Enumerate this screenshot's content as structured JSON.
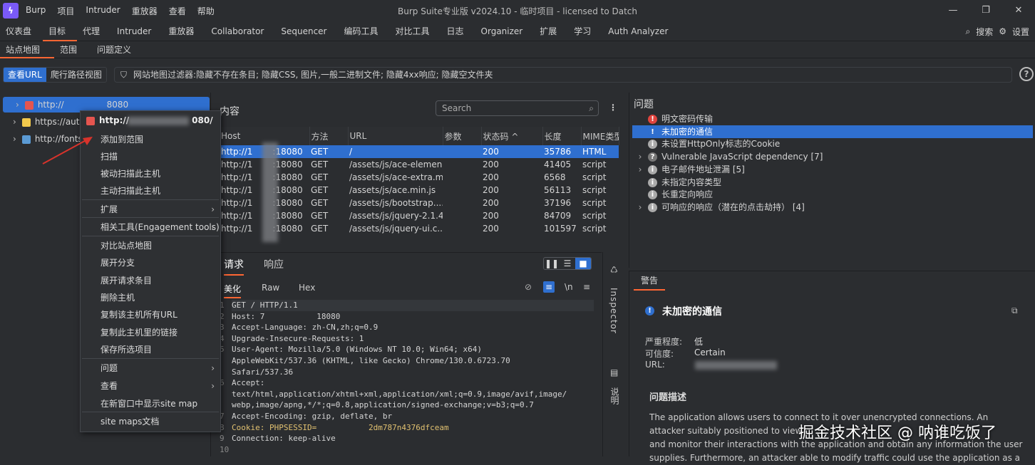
{
  "titlebar": {
    "menus": [
      "Burp",
      "项目",
      "Intruder",
      "重放器",
      "查看",
      "帮助"
    ],
    "title": "Burp Suite专业版  v2024.10 - 临时项目 - licensed to Datch"
  },
  "main_tabs": [
    "仪表盘",
    "目标",
    "代理",
    "Intruder",
    "重放器",
    "Collaborator",
    "Sequencer",
    "编码工具",
    "对比工具",
    "日志",
    "Organizer",
    "扩展",
    "学习",
    "Auth Analyzer"
  ],
  "main_tabs_right": {
    "search": "搜索",
    "settings": "设置"
  },
  "sub_tabs": [
    "站点地图",
    "范围",
    "问题定义"
  ],
  "view_toggle": {
    "url": "查看URL",
    "crawl": "爬行路径视图"
  },
  "filter_text": "网站地图过滤器:隐藏不存在条目; 隐藏CSS, 图片,一般二进制文件; 隐藏4xx响应; 隐藏空文件夹",
  "tree": [
    {
      "label": "http://",
      "suffix": "8080",
      "color": "#e5554f"
    },
    {
      "label": "https://auth",
      "suffix": "",
      "color": "#f2c94c"
    },
    {
      "label": "http://fonts",
      "suffix": "",
      "color": "#5b9bd5"
    }
  ],
  "context_menu": {
    "header": "http://",
    "header_suffix": "080/",
    "items": [
      "添加到范围",
      "扫描",
      "被动扫描此主机",
      "主动扫描此主机",
      "扩展",
      "相关工具(Engagement tools)",
      "对比站点地图",
      "展开分支",
      "展开请求条目",
      "删除主机",
      "复制该主机所有URL",
      "复制此主机里的链接",
      "保存所选项目",
      "问题",
      "查看",
      "在新窗口中显示site map",
      "site maps文档"
    ]
  },
  "content": {
    "title": "内容",
    "search_placeholder": "Search",
    "columns": [
      "Host",
      "方法",
      "URL",
      "参数",
      "状态码 ^",
      "长度",
      "MIME类型"
    ],
    "rows": [
      [
        "http://1",
        "GET",
        "/",
        "",
        "200",
        "35786",
        "HTML"
      ],
      [
        "http://1",
        "GET",
        "/assets/js/ace-elemen...",
        "",
        "200",
        "41405",
        "script"
      ],
      [
        "http://1",
        "GET",
        "/assets/js/ace-extra.m...",
        "",
        "200",
        "6568",
        "script"
      ],
      [
        "http://1",
        "GET",
        "/assets/js/ace.min.js",
        "",
        "200",
        "56113",
        "script"
      ],
      [
        "http://1",
        "GET",
        "/assets/js/bootstrap....",
        "",
        "200",
        "37196",
        "script"
      ],
      [
        "http://1",
        "GET",
        "/assets/js/jquery-2.1.4...",
        "",
        "200",
        "84709",
        "script"
      ],
      [
        "http://1",
        "GET",
        "/assets/js/jquery-ui.c...",
        "",
        "200",
        "101597",
        "script"
      ]
    ],
    "host_suffix": ":18080"
  },
  "request": {
    "tabs": [
      "请求",
      "响应"
    ],
    "view_tabs": [
      "美化",
      "Raw",
      "Hex"
    ],
    "newline_label": "\\n",
    "lines": [
      "GET / HTTP/1.1",
      "Host: 7           18080",
      "Accept-Language: zh-CN,zh;q=0.9",
      "Upgrade-Insecure-Requests: 1",
      "User-Agent: Mozilla/5.0 (Windows NT 10.0; Win64; x64)",
      "AppleWebKit/537.36 (KHTML, like Gecko) Chrome/130.0.6723.70",
      "Safari/537.36",
      "Accept:",
      "text/html,application/xhtml+xml,application/xml;q=0.9,image/avif,image/",
      "webp,image/apng,*/*;q=0.8,application/signed-exchange;v=b3;q=0.7",
      "Accept-Encoding: gzip, deflate, br",
      "Cookie: PHPSESSID=           2dm787n4376dfceam",
      "Connection: keep-alive"
    ],
    "line_numbers": [
      "1",
      "2",
      "3",
      "4",
      "5",
      "",
      "",
      "6",
      "",
      "",
      "7",
      "8",
      "9",
      "10"
    ]
  },
  "inspector": {
    "label": "Inspector",
    "notes": "说明"
  },
  "issues": {
    "title": "问题",
    "items": [
      {
        "label": "明文密码传输",
        "icon": "!",
        "color": "#e0443e"
      },
      {
        "label": "未加密的通信",
        "icon": "!",
        "color": "#2f6fcf"
      },
      {
        "label": "未设置HttpOnly标志的Cookie",
        "icon": "i",
        "color": "#aaaaaa"
      },
      {
        "label": "Vulnerable JavaScript dependency [7]",
        "icon": "?",
        "color": "#777777"
      },
      {
        "label": "电子邮件地址泄漏 [5]",
        "icon": "i",
        "color": "#aaaaaa"
      },
      {
        "label": "未指定内容类型",
        "icon": "i",
        "color": "#aaaaaa"
      },
      {
        "label": "长重定向响应",
        "icon": "i",
        "color": "#aaaaaa"
      },
      {
        "label": "可响应的响应（潜在的点击劫持） [4]",
        "icon": "i",
        "color": "#aaaaaa"
      }
    ]
  },
  "advisory": {
    "tab": "警告",
    "title": "未加密的通信",
    "severity_label": "严重程度:",
    "severity": "低",
    "confidence_label": "可信度:",
    "confidence": "Certain",
    "url_label": "URL:",
    "desc_title": "问题描述",
    "desc_lines": [
      "The application allows users to connect to it over unencrypted connections. An",
      "attacker suitably positioned to view",
      "and monitor their interactions with the application and obtain any information the user",
      "supplies. Furthermore, an attacker able to modify traffic could use the application as a"
    ]
  },
  "watermark": "掘金技术社区 @ 呐谁吃饭了",
  "colors": {
    "accent": "#2f6fcf",
    "tab_underline": "#ff6633",
    "bg": "#2b2d30"
  }
}
